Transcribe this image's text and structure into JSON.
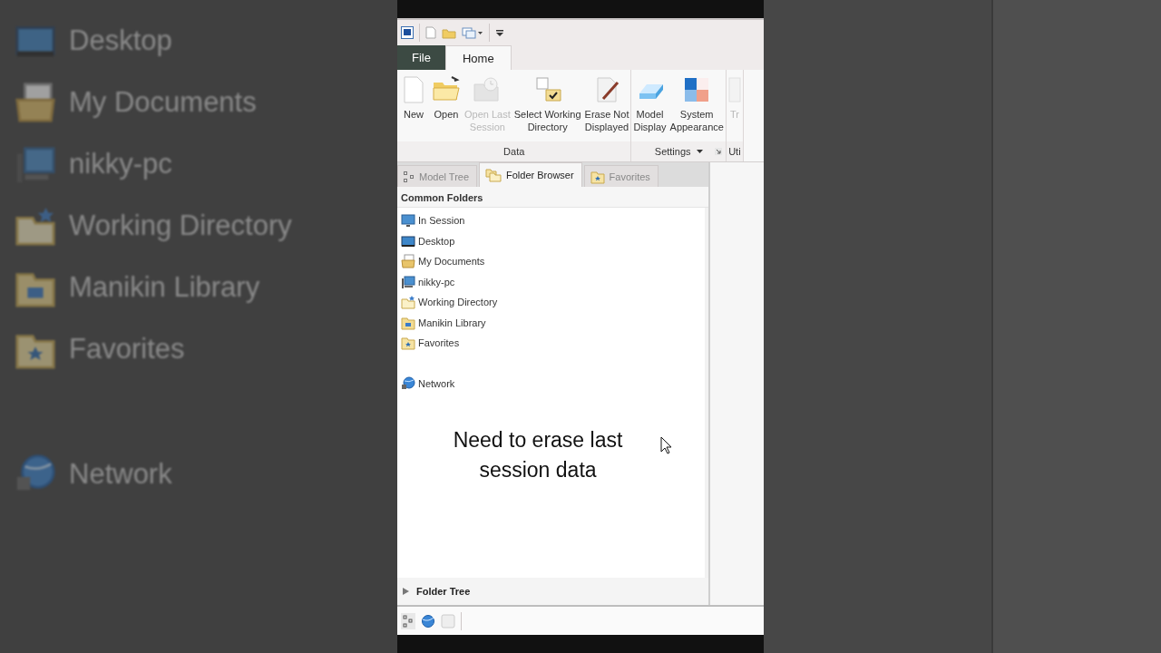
{
  "backdrop": {
    "items": [
      {
        "label": "Desktop",
        "kind": "desktop"
      },
      {
        "label": "My Documents",
        "kind": "documents"
      },
      {
        "label": "nikky-pc",
        "kind": "computer"
      },
      {
        "label": "Working Directory",
        "kind": "working"
      },
      {
        "label": "Manikin Library",
        "kind": "library"
      },
      {
        "label": "Favorites",
        "kind": "favorites"
      },
      {
        "label": "Network",
        "kind": "network"
      }
    ]
  },
  "menu_tabs": [
    {
      "label": "File",
      "kind": "file",
      "selected": false
    },
    {
      "label": "Home",
      "kind": "tab",
      "selected": true
    }
  ],
  "ribbon": {
    "groups": [
      {
        "label": "Data",
        "items": [
          {
            "lines": [
              "New"
            ],
            "kind": "new",
            "disabled": false
          },
          {
            "lines": [
              "Open"
            ],
            "kind": "open",
            "disabled": false
          },
          {
            "lines": [
              "Open Last",
              "Session"
            ],
            "kind": "last",
            "disabled": true
          },
          {
            "lines": [
              "Select Working",
              "Directory"
            ],
            "kind": "select",
            "disabled": false
          },
          {
            "lines": [
              "Erase Not",
              "Displayed"
            ],
            "kind": "erase",
            "disabled": false
          }
        ]
      },
      {
        "label": "Settings",
        "dropdown": true,
        "launcher": true,
        "items": [
          {
            "lines": [
              "Model",
              "Display"
            ],
            "kind": "model",
            "disabled": false
          },
          {
            "lines": [
              "System",
              "Appearance"
            ],
            "kind": "appearance",
            "disabled": false
          }
        ]
      },
      {
        "label": "Uti",
        "items": [
          {
            "lines": [
              "Tr"
            ],
            "kind": "doc",
            "disabled": true
          }
        ]
      }
    ]
  },
  "panel_tabs": [
    {
      "label": "Model Tree",
      "kind": "tree",
      "selected": false
    },
    {
      "label": "Folder Browser",
      "kind": "folders",
      "selected": true
    },
    {
      "label": "Favorites",
      "kind": "favorites",
      "selected": false
    }
  ],
  "common_folders": {
    "heading": "Common Folders",
    "items": [
      {
        "label": "In Session",
        "kind": "monitor"
      },
      {
        "label": "Desktop",
        "kind": "desktop"
      },
      {
        "label": "My Documents",
        "kind": "documents"
      },
      {
        "label": "nikky-pc",
        "kind": "computer"
      },
      {
        "label": "Working Directory",
        "kind": "working"
      },
      {
        "label": "Manikin Library",
        "kind": "library"
      },
      {
        "label": "Favorites",
        "kind": "favorites"
      },
      {
        "label": "Network",
        "kind": "network"
      }
    ]
  },
  "caption": "Need to erase last session data",
  "folder_tree": {
    "label": "Folder Tree",
    "expanded": false
  }
}
